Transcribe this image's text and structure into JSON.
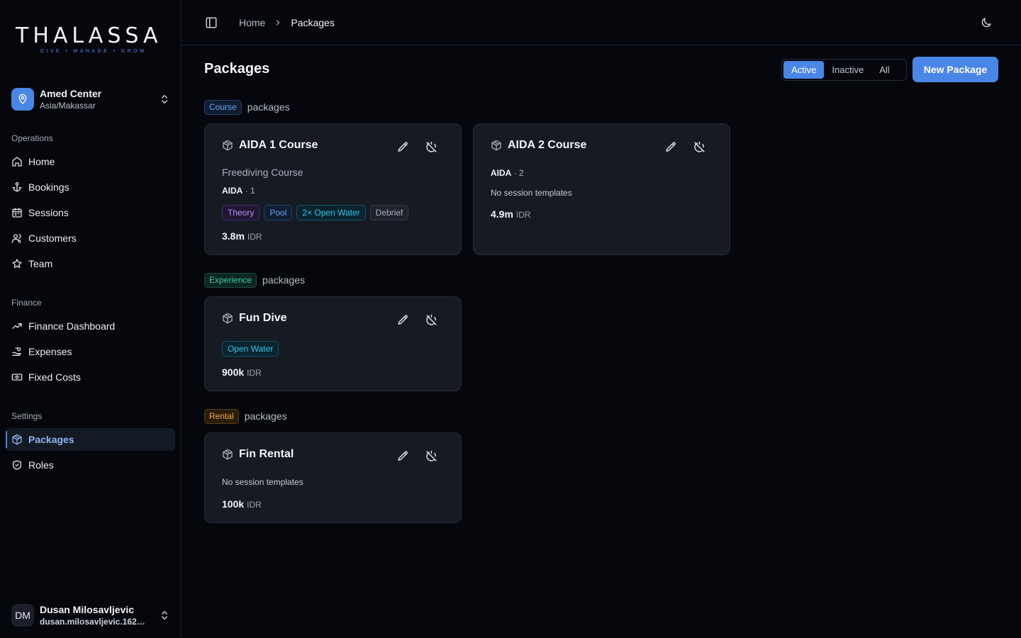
{
  "brand": {
    "wordmark": "THALASSA",
    "tagline": "DIVE • MANAGE • GROW"
  },
  "center": {
    "name": "Amed Center",
    "timezone": "Asia/Makassar"
  },
  "nav": {
    "operations_label": "Operations",
    "operations": [
      {
        "label": "Home",
        "icon": "home-icon"
      },
      {
        "label": "Bookings",
        "icon": "anchor-icon"
      },
      {
        "label": "Sessions",
        "icon": "calendar-icon"
      },
      {
        "label": "Customers",
        "icon": "users-icon"
      },
      {
        "label": "Team",
        "icon": "star-icon"
      }
    ],
    "finance_label": "Finance",
    "finance": [
      {
        "label": "Finance Dashboard",
        "icon": "trending-up-icon"
      },
      {
        "label": "Expenses",
        "icon": "hand-coins-icon"
      },
      {
        "label": "Fixed Costs",
        "icon": "banknote-icon"
      }
    ],
    "settings_label": "Settings",
    "settings": [
      {
        "label": "Packages",
        "icon": "package-icon",
        "active": true
      },
      {
        "label": "Roles",
        "icon": "shield-check-icon"
      }
    ]
  },
  "user": {
    "initials": "DM",
    "name": "Dusan Milosavljevic",
    "email": "dusan.milosavljevic.1624..."
  },
  "breadcrumb": {
    "home": "Home",
    "current": "Packages"
  },
  "page": {
    "title": "Packages",
    "filters": [
      "Active",
      "Inactive",
      "All"
    ],
    "active_filter": "Active",
    "new_button": "New Package"
  },
  "sections": {
    "suffix": "packages",
    "course": {
      "label": "Course",
      "cards": [
        {
          "title": "AIDA 1 Course",
          "description": "Freediving Course",
          "agency": "AIDA",
          "level": "· 1",
          "chips": [
            "Theory",
            "Pool",
            "2× Open Water",
            "Debrief"
          ],
          "price": "3.8m",
          "currency": "IDR"
        },
        {
          "title": "AIDA 2 Course",
          "agency": "AIDA",
          "level": "· 2",
          "note": "No session templates",
          "price": "4.9m",
          "currency": "IDR"
        }
      ]
    },
    "experience": {
      "label": "Experience",
      "cards": [
        {
          "title": "Fun Dive",
          "chips": [
            "Open Water"
          ],
          "price": "900k",
          "currency": "IDR"
        }
      ]
    },
    "rental": {
      "label": "Rental",
      "cards": [
        {
          "title": "Fin Rental",
          "note": "No session templates",
          "price": "100k",
          "currency": "IDR"
        }
      ]
    }
  },
  "colors": {
    "accent": "#4a86e6",
    "background": "#05070c",
    "card": "#161b23",
    "course": "#6ea2f2",
    "experience": "#35c9a6",
    "rental": "#f1a838"
  }
}
